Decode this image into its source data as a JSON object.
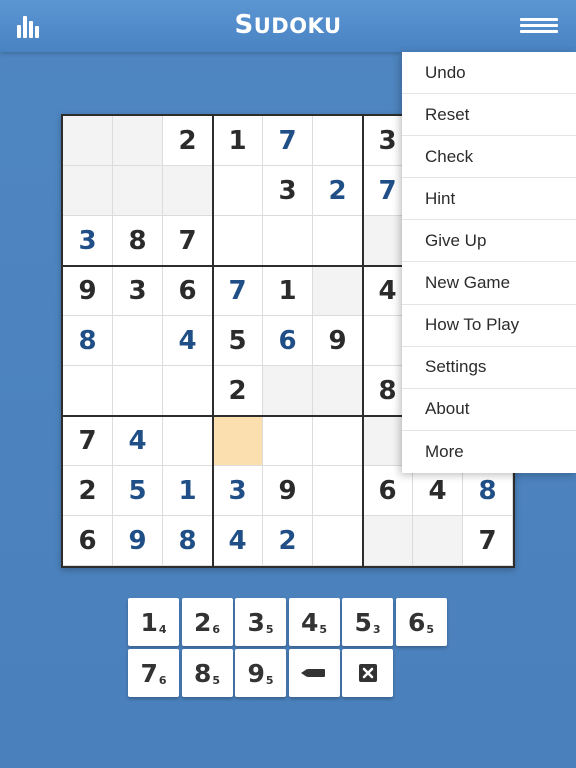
{
  "header": {
    "title_initial": "S",
    "title_rest": "UDOKU",
    "stats_icon": "bar-chart-icon",
    "menu_icon": "hamburger-menu-icon"
  },
  "board": {
    "rows": [
      [
        "",
        "",
        "2",
        "1",
        "7",
        "",
        "3",
        "",
        ""
      ],
      [
        "",
        "",
        "",
        "",
        "3",
        "2",
        "7",
        "",
        ""
      ],
      [
        "3",
        "8",
        "7",
        "",
        "",
        "",
        "",
        "",
        ""
      ],
      [
        "9",
        "3",
        "6",
        "7",
        "1",
        "",
        "4",
        "",
        ""
      ],
      [
        "8",
        "",
        "4",
        "5",
        "6",
        "9",
        "",
        "",
        ""
      ],
      [
        "",
        "",
        "",
        "2",
        "",
        "",
        "8",
        "",
        ""
      ],
      [
        "7",
        "4",
        "",
        "",
        "",
        "",
        "",
        "",
        ""
      ],
      [
        "2",
        "5",
        "1",
        "3",
        "9",
        "",
        "6",
        "4",
        "8"
      ],
      [
        "6",
        "9",
        "8",
        "4",
        "2",
        "",
        "",
        "",
        "7"
      ]
    ],
    "user_entered": [
      [
        0,
        4
      ],
      [
        1,
        5
      ],
      [
        1,
        6
      ],
      [
        2,
        0
      ],
      [
        3,
        3
      ],
      [
        4,
        0
      ],
      [
        4,
        2
      ],
      [
        4,
        4
      ],
      [
        6,
        1
      ],
      [
        7,
        1
      ],
      [
        7,
        2
      ],
      [
        7,
        3
      ],
      [
        7,
        8
      ],
      [
        8,
        1
      ],
      [
        8,
        2
      ],
      [
        8,
        3
      ],
      [
        8,
        4
      ]
    ],
    "selected_cell": [
      6,
      3
    ],
    "highlight_color": "#fbdfae",
    "user_digit_color": "#1f4f86",
    "given_digit_color": "#2b2b2b"
  },
  "keypad": {
    "keys": [
      {
        "digit": "1",
        "count": "4"
      },
      {
        "digit": "2",
        "count": "6"
      },
      {
        "digit": "3",
        "count": "5"
      },
      {
        "digit": "4",
        "count": "5"
      },
      {
        "digit": "5",
        "count": "3"
      },
      {
        "digit": "6",
        "count": "5"
      },
      {
        "digit": "7",
        "count": "6"
      },
      {
        "digit": "8",
        "count": "5"
      },
      {
        "digit": "9",
        "count": "5"
      }
    ],
    "pencil_icon": "pencil-icon",
    "erase_icon": "erase-icon"
  },
  "menu": {
    "items": [
      "Undo",
      "Reset",
      "Check",
      "Hint",
      "Give Up",
      "New Game",
      "How To Play",
      "Settings",
      "About",
      "More"
    ]
  },
  "colors": {
    "background": "#4a80bb",
    "header": "#5b95d2"
  }
}
